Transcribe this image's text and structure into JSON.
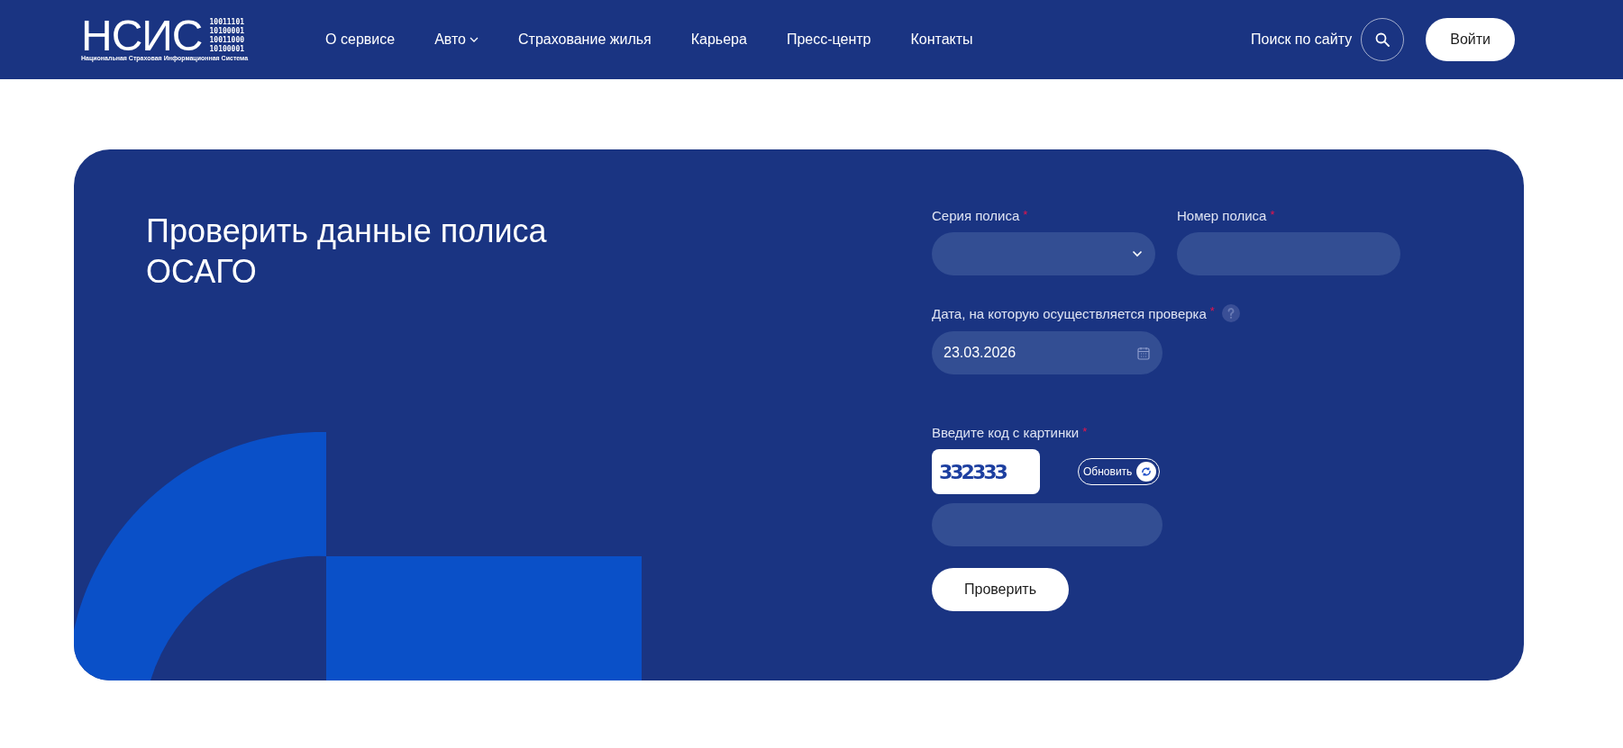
{
  "header": {
    "logo": {
      "mark": "НСИС",
      "binary": [
        "10011101",
        "10100001",
        "10011000",
        "10100001"
      ],
      "subtitle": "Национальная Страховая Информационная Система"
    },
    "nav": [
      {
        "label": "О сервисе",
        "dropdown": false
      },
      {
        "label": "Авто",
        "dropdown": true
      },
      {
        "label": "Страхование жилья",
        "dropdown": false
      },
      {
        "label": "Карьера",
        "dropdown": false
      },
      {
        "label": "Пресс-центр",
        "dropdown": false
      },
      {
        "label": "Контакты",
        "dropdown": false
      }
    ],
    "search_label": "Поиск по сайту",
    "login": "Войти"
  },
  "card": {
    "title": "Проверить данные полиса ОСАГО",
    "fields": [
      {
        "kind": "select",
        "label": "Серия полиса",
        "required_mark": "*"
      },
      {
        "kind": "text",
        "label": "Номер полиса",
        "required_mark": "*"
      },
      {
        "kind": "date",
        "label": "Дата, на которую осуществляется проверка",
        "required_mark": "*",
        "help": true,
        "value": "23.03.2026"
      }
    ],
    "captcha": {
      "label": "Введите код с картинки",
      "required_mark": "*",
      "code": "332333",
      "refresh": "Обновить"
    },
    "submit": "Проверить"
  }
}
